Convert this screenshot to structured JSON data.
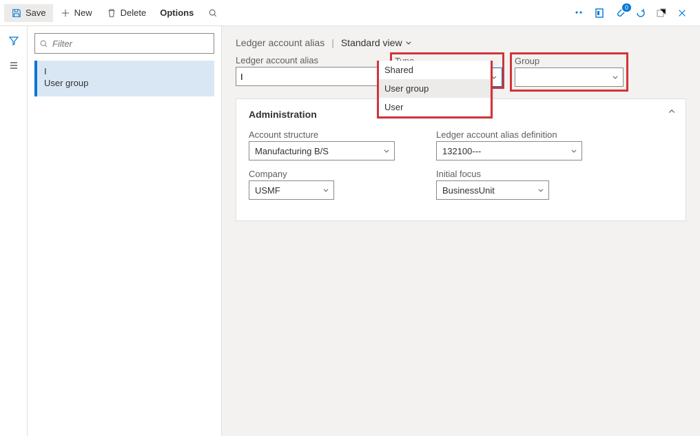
{
  "toolbar": {
    "save": "Save",
    "new": "New",
    "delete": "Delete",
    "options": "Options"
  },
  "notification_count": "0",
  "filter_placeholder": "Filter",
  "list": {
    "item1_line1": "I",
    "item1_line2": "User group"
  },
  "breadcrumb": {
    "title": "Ledger account alias",
    "view": "Standard view"
  },
  "fields": {
    "alias_label": "Ledger account alias",
    "alias_value": "I",
    "type_label": "Type",
    "type_value": "User group",
    "type_options": {
      "o1": "Shared",
      "o2": "User group",
      "o3": "User"
    },
    "group_label": "Group",
    "group_value": ""
  },
  "admin": {
    "heading": "Administration",
    "account_structure_label": "Account structure",
    "account_structure_value": "Manufacturing B/S",
    "definition_label": "Ledger account alias definition",
    "definition_value": "132100---",
    "company_label": "Company",
    "company_value": "USMF",
    "initial_focus_label": "Initial focus",
    "initial_focus_value": "BusinessUnit"
  }
}
